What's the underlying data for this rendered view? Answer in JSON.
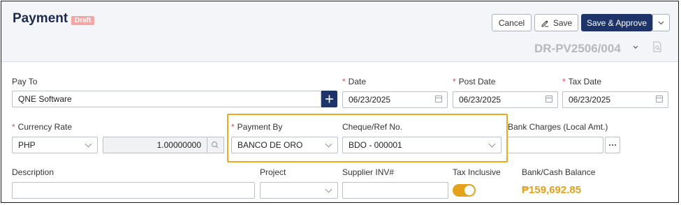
{
  "header": {
    "title": "Payment",
    "status_badge": "Draft",
    "cancel_label": "Cancel",
    "save_label": "Save",
    "save_approve_label": "Save & Approve",
    "document_no": "DR-PV2506/004"
  },
  "form": {
    "pay_to": {
      "label": "Pay To",
      "value": "QNE Software"
    },
    "date": {
      "label": "Date",
      "value": "06/23/2025"
    },
    "post_date": {
      "label": "Post Date",
      "value": "06/23/2025"
    },
    "tax_date": {
      "label": "Tax Date",
      "value": "06/23/2025"
    },
    "currency_rate": {
      "label": "Currency Rate",
      "currency": "PHP",
      "rate": "1.00000000"
    },
    "payment_by": {
      "label": "Payment By",
      "value": "BANCO DE ORO"
    },
    "cheque_ref": {
      "label": "Cheque/Ref No.",
      "value": "BDO - 000001"
    },
    "bank_charges": {
      "label": "Bank Charges (Local Amt.)",
      "value": ""
    },
    "description": {
      "label": "Description",
      "value": ""
    },
    "project": {
      "label": "Project",
      "value": ""
    },
    "supplier_inv": {
      "label": "Supplier INV#",
      "value": ""
    },
    "tax_inclusive": {
      "label": "Tax Inclusive",
      "on": true
    },
    "balance": {
      "label": "Bank/Cash Balance",
      "value": "₱159,692.85"
    }
  },
  "colors": {
    "primary": "#1e3469",
    "accent": "#e3a21a",
    "highlight": "#f0a81d",
    "required": "#e34b4b"
  },
  "icons": [
    "pencil-icon",
    "chevron-down-icon",
    "document-search-icon",
    "plus-icon",
    "calendar-icon",
    "search-icon",
    "more-icon"
  ]
}
